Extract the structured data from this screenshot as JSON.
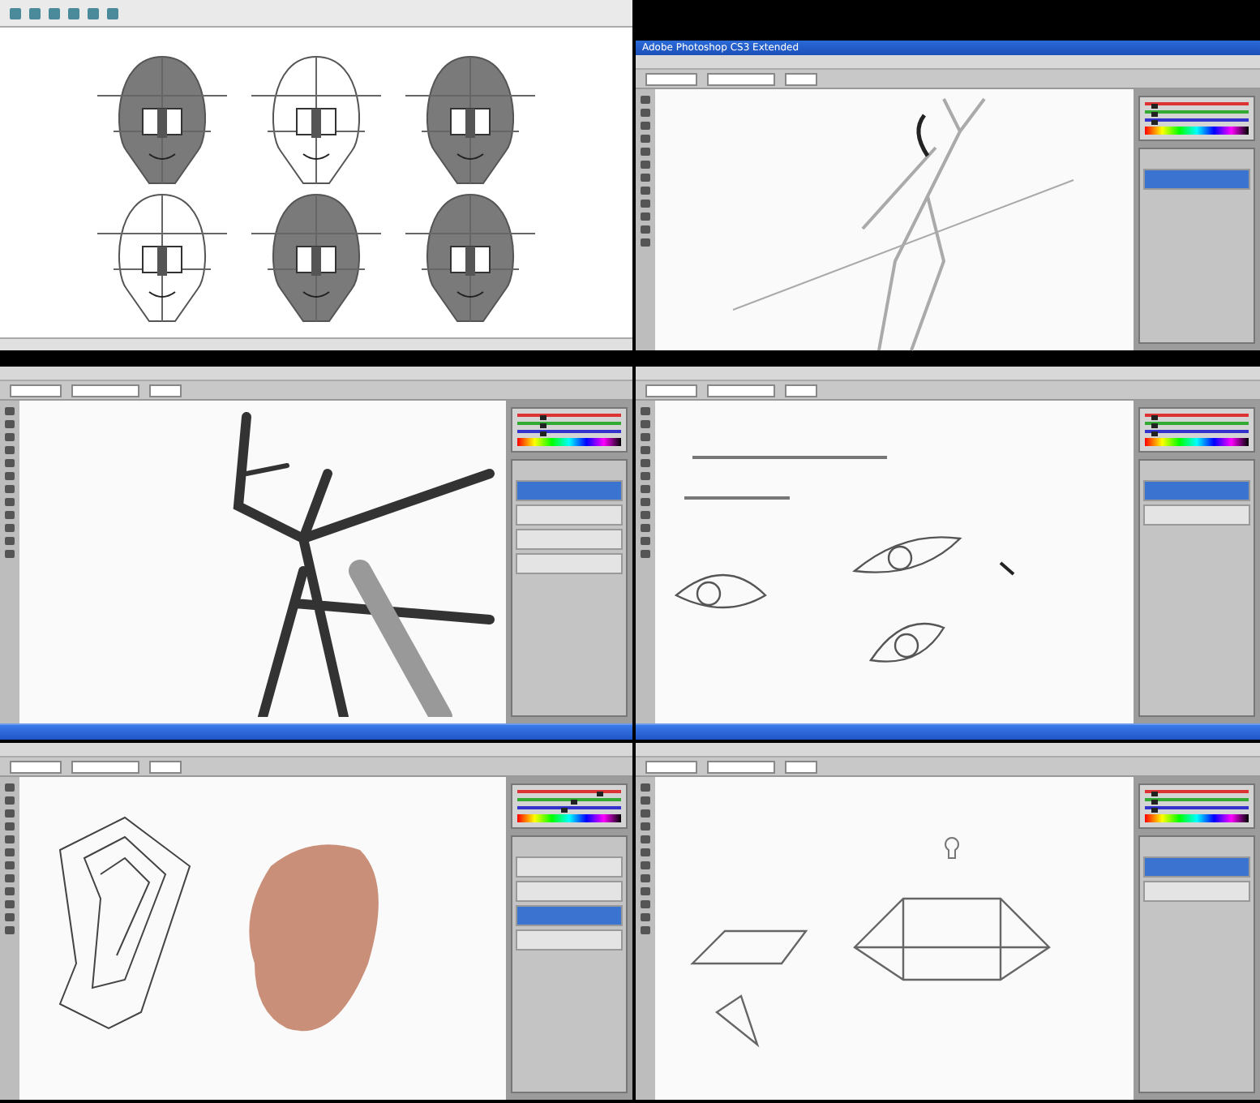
{
  "panels": [
    {
      "kind": "viewer",
      "canvas": {
        "kind": "faces"
      },
      "taskbar": false
    },
    {
      "kind": "photoshop",
      "title": "Adobe Photoshop CS3 Extended",
      "canvas": {
        "kind": "figure"
      },
      "taskbar": false,
      "sliders": [
        {
          "level": 0.1
        },
        {
          "level": 0.1
        },
        {
          "level": 0.1
        }
      ],
      "layers": [
        {
          "selected": true
        }
      ]
    },
    {
      "kind": "photoshop",
      "canvas": {
        "kind": "closeup"
      },
      "taskbar": true,
      "sliders": [
        {
          "level": 0.25
        },
        {
          "level": 0.25
        },
        {
          "level": 0.25
        }
      ],
      "layers": [
        {
          "selected": true
        },
        {
          "selected": false
        },
        {
          "selected": false
        },
        {
          "selected": false
        }
      ]
    },
    {
      "kind": "photoshop",
      "canvas": {
        "kind": "eyes"
      },
      "taskbar": true,
      "sliders": [
        {
          "level": 0.1
        },
        {
          "level": 0.1
        },
        {
          "level": 0.1
        }
      ],
      "layers": [
        {
          "selected": true
        },
        {
          "selected": false
        }
      ]
    },
    {
      "kind": "photoshop",
      "canvas": {
        "kind": "ear"
      },
      "taskbar": false,
      "sliders": [
        {
          "level": 0.8
        },
        {
          "level": 0.55
        },
        {
          "level": 0.45
        }
      ],
      "layers": [
        {
          "selected": false
        },
        {
          "selected": false
        },
        {
          "selected": true
        },
        {
          "selected": false
        }
      ]
    },
    {
      "kind": "photoshop",
      "canvas": {
        "kind": "lips"
      },
      "taskbar": false,
      "sliders": [
        {
          "level": 0.1
        },
        {
          "level": 0.1
        },
        {
          "level": 0.1
        }
      ],
      "layers": [
        {
          "selected": true
        },
        {
          "selected": false
        }
      ]
    }
  ]
}
